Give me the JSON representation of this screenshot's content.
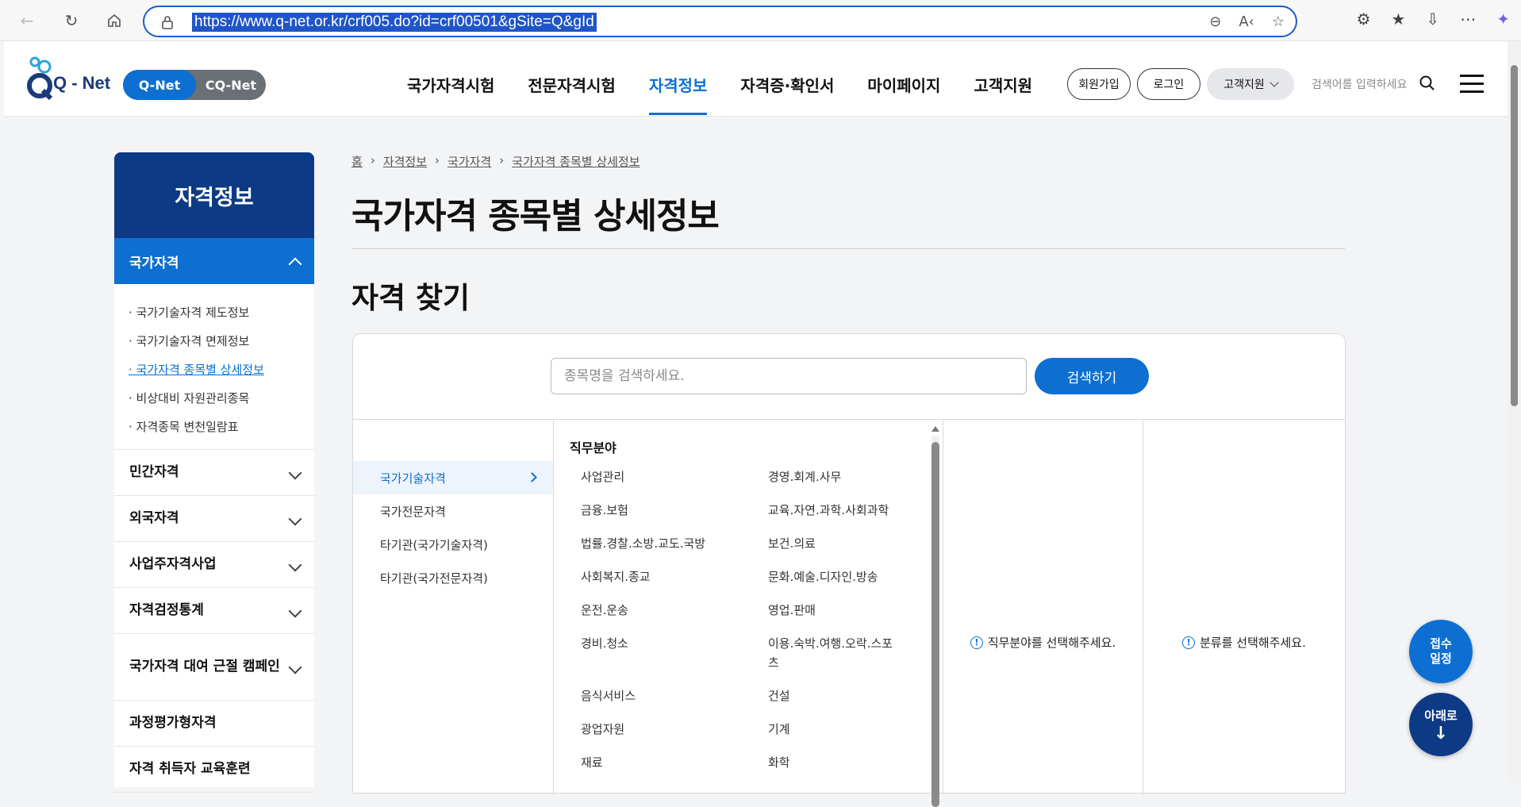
{
  "browser": {
    "url": "https://www.q-net.or.kr/crf005.do?id=crf00501&gSite=Q&gId"
  },
  "header": {
    "logo_text": "Q - Net",
    "site_switch": {
      "active": "Q-Net",
      "inactive": "CQ-Net"
    },
    "gnb": [
      "국가자격시험",
      "전문자격시험",
      "자격정보",
      "자격증·확인서",
      "마이페이지",
      "고객지원"
    ],
    "active_gnb": "자격정보",
    "signup": "회원가입",
    "login": "로그인",
    "support_dropdown": "고객지원",
    "search_placeholder": "검색어를 입력하세요"
  },
  "sidebar": {
    "title": "자격정보",
    "active_category": "국가자격",
    "sub_items": [
      "국가기술자격 제도정보",
      "국가기술자격 면제정보",
      "국가자격 종목별 상세정보",
      "비상대비 자원관리종목",
      "자격종목 변천일람표"
    ],
    "selected_sub": "국가자격 종목별 상세정보",
    "categories": [
      "민간자격",
      "외국자격",
      "사업주자격사업",
      "자격검정통계",
      "국가자격 대여 근절 캠페인",
      "과정평가형자격",
      "자격 취득자 교육훈련"
    ]
  },
  "breadcrumb": [
    "홈",
    "자격정보",
    "국가자격",
    "국가자격 종목별 상세정보"
  ],
  "page_title": "국가자격 종목별 상세정보",
  "section_title": "자격 찾기",
  "search": {
    "placeholder": "종목명을 검색하세요.",
    "button": "검색하기"
  },
  "qualification_types": [
    "국가기술자격",
    "국가전문자격",
    "타기관(국가기술자격)",
    "타기관(국가전문자격)"
  ],
  "selected_type": "국가기술자격",
  "job_field_header": "직무분야",
  "job_fields": [
    "사업관리",
    "경영.회계.사무",
    "금융.보험",
    "교육.자연.과학.사회과학",
    "법률.경찰.소방.교도.국방",
    "보건.의료",
    "사회복지.종교",
    "문화.예술.디자인.방송",
    "운전.운송",
    "영업.판매",
    "경비.청소",
    "이용.숙박.여행.오락.스포츠",
    "음식서비스",
    "건설",
    "광업자원",
    "기계",
    "재료",
    "화학"
  ],
  "notices": {
    "select_field": "직무분야를 선택해주세요.",
    "select_category": "분류를 선택해주세요."
  },
  "floating": {
    "schedule_line1": "접수",
    "schedule_line2": "일정",
    "down": "아래로"
  },
  "colors": {
    "primary": "#0c6fd1",
    "navy": "#0d3a84"
  }
}
